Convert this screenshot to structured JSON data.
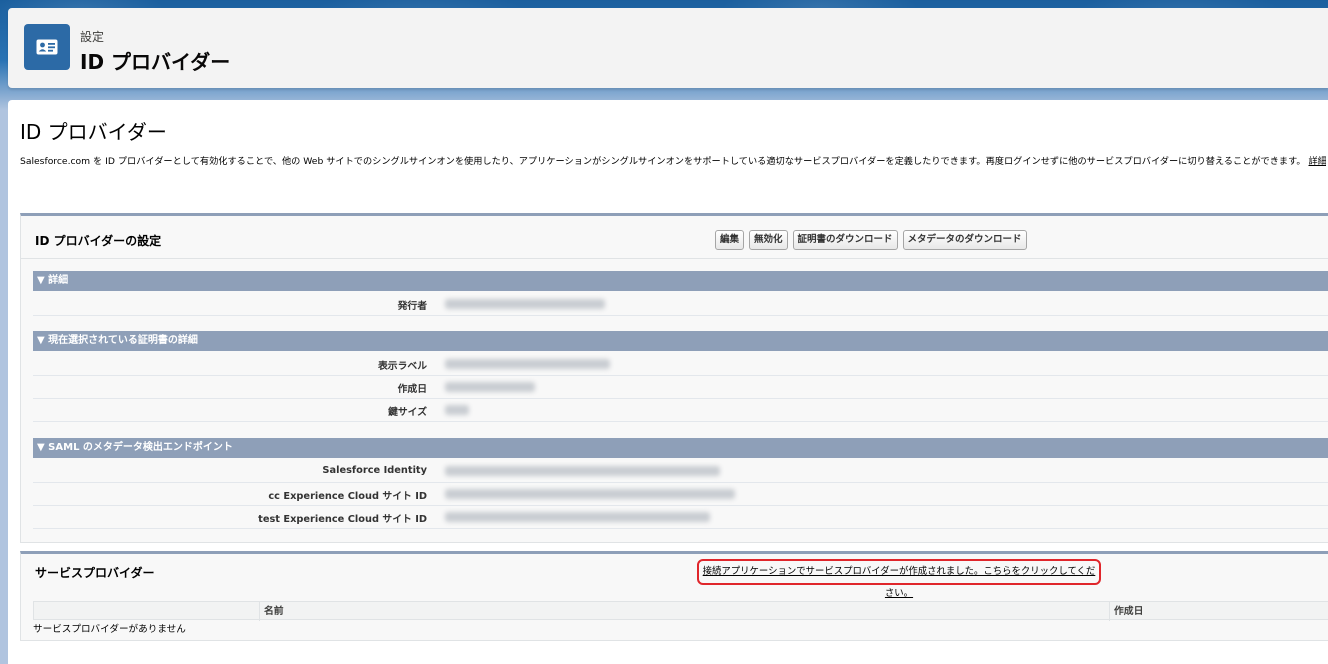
{
  "header": {
    "overline": "設定",
    "title": "ID プロバイダー",
    "icon": "id-card-icon",
    "icon_color": "#2c6aa6"
  },
  "page": {
    "title": "ID プロバイダー",
    "description": "Salesforce.com を ID プロバイダーとして有効化することで、他の Web サイトでのシングルサインオンを使用したり、アプリケーションがシングルサインオンをサポートしている適切なサービスプロバイダーを定義したりできます。再度ログインせずに他のサービスプロバイダーに切り替えることができます。",
    "help_link": "詳細はこちら..."
  },
  "settings": {
    "title": "ID プロバイダーの設定",
    "buttons": {
      "edit": "編集",
      "disable": "無効化",
      "download_cert": "証明書のダウンロード",
      "download_metadata": "メタデータのダウンロード"
    },
    "sections": {
      "details": {
        "title": "▼ 詳細",
        "rows": [
          {
            "label": "発行者"
          }
        ]
      },
      "certificate": {
        "title": "▼ 現在選択されている証明書の詳細",
        "rows": [
          {
            "label": "表示ラベル"
          },
          {
            "label": "作成日"
          },
          {
            "label": "鍵サイズ"
          }
        ]
      },
      "saml": {
        "title": "▼ SAML のメタデータ検出エンドポイント",
        "rows": [
          {
            "label": "Salesforce Identity"
          },
          {
            "label": "cc Experience Cloud サイト ID"
          },
          {
            "label": "test Experience Cloud サイト ID"
          }
        ]
      }
    }
  },
  "service_providers": {
    "title": "サービスプロバイダー",
    "notice_link": "接続アプリケーションでサービスプロバイダーが作成されました。こちらをクリックしてください。",
    "columns": {
      "name": "名前",
      "created": "作成日"
    },
    "empty_message": "サービスプロバイダーがありません"
  },
  "colors": {
    "section_header": "#8e9fb8",
    "highlight_border": "#e0262b",
    "brand_blue": "#1b5f9e"
  }
}
